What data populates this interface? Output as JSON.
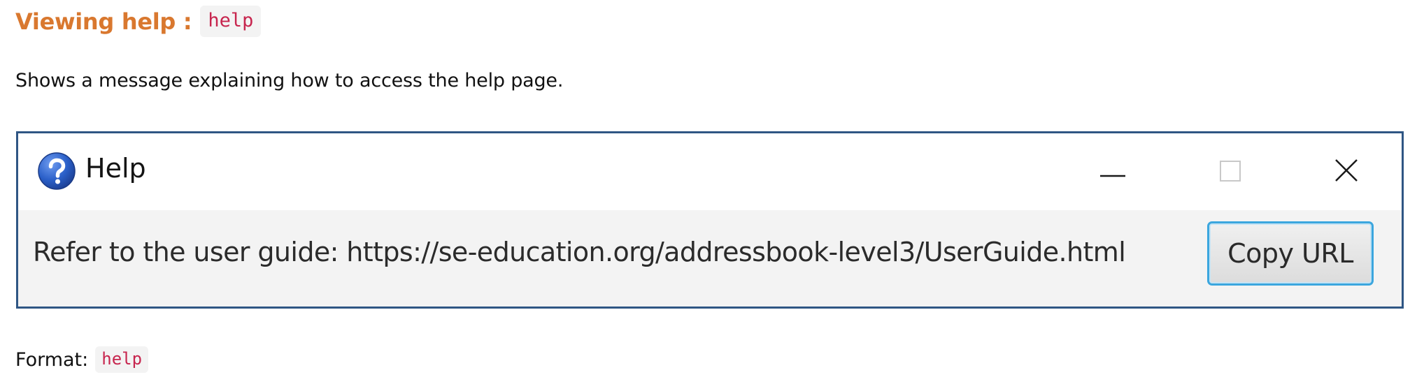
{
  "section": {
    "heading": "Viewing help :",
    "heading_code": "help",
    "description": "Shows a message explaining how to access the help page.",
    "format_label": "Format:",
    "format_code": "help"
  },
  "help_window": {
    "title": "Help",
    "title_icon": "question-mark-icon",
    "controls": [
      "minimize-icon",
      "maximize-icon",
      "close-icon"
    ],
    "message": "Refer to the user guide: https://se-education.org/addressbook-level3/UserGuide.html",
    "copy_button_label": "Copy URL"
  },
  "colors": {
    "heading": "#d9782f",
    "code_text": "#c7254e",
    "code_background": "#f3f3f3",
    "window_border": "#2f5684",
    "button_focus": "#3ba6de",
    "icon_blue": "#2a5fc8"
  }
}
